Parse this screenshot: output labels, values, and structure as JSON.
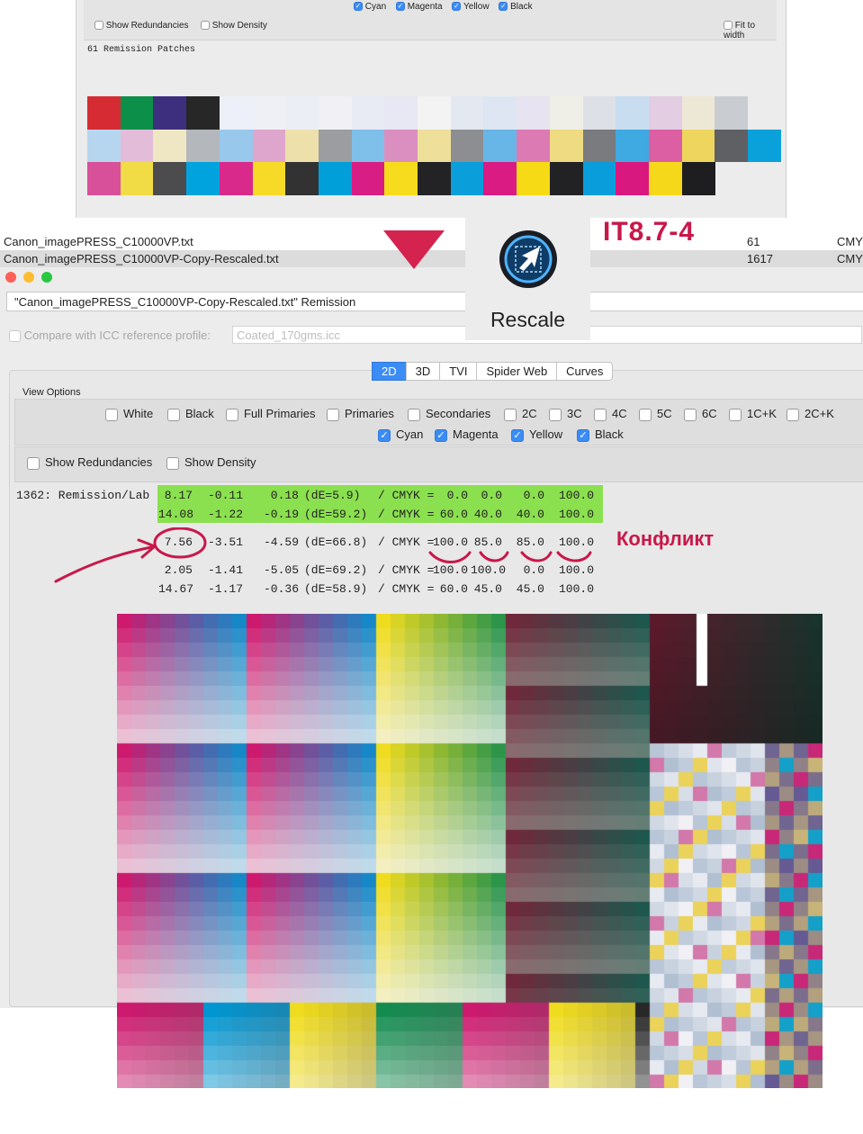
{
  "top_window": {
    "channels": [
      {
        "label": "Cyan",
        "checked": true
      },
      {
        "label": "Magenta",
        "checked": true
      },
      {
        "label": "Yellow",
        "checked": true
      },
      {
        "label": "Black",
        "checked": true
      }
    ],
    "show_redundancies": "Show Redundancies",
    "show_density": "Show Density",
    "fit_to_width": "Fit to width",
    "patch_count_label": "61 Remission Patches",
    "patch_rows": [
      [
        "#d62b33",
        "#0c8f48",
        "#3e2f7e",
        "#272727",
        "#edf0f8",
        "#eff0f6",
        "#eceef6",
        "#f1f1f5",
        "#e8eaf4",
        "#e7e8f3",
        "#f3f3f3",
        "#e4e8f1",
        "#dde6f2",
        "#e8e3f0",
        "#efefe8",
        "#dde0e6",
        "#c8ddf0",
        "#e3cde3",
        "#ede8d6",
        "#c9cdd2"
      ],
      [
        "#b6d6ef",
        "#e2bcd8",
        "#efe6c3",
        "#b4b7bb",
        "#98c8ec",
        "#dfa6cd",
        "#ede0ab",
        "#9b9da0",
        "#7fc0ea",
        "#db8fc1",
        "#eee09a",
        "#8c8e92",
        "#67b6e7",
        "#dc7ab4",
        "#eedb82",
        "#7a7b7f",
        "#3fa9e1",
        "#dc5fa4",
        "#eed65e",
        "#5f6064",
        "#0aa0d9"
      ],
      [
        "#d9509a",
        "#f2dc46",
        "#4c4c4e",
        "#00a3dd",
        "#d92a8b",
        "#f7d928",
        "#323233",
        "#009fda",
        "#d81e84",
        "#f6dc1d",
        "#232325",
        "#0a9edb",
        "#da1b84",
        "#f6da16",
        "#222224",
        "#0a9ddc",
        "#d9187f",
        "#f6d81b",
        "#1e1e20"
      ]
    ]
  },
  "file_list": [
    {
      "name": "Canon_imagePRESS_C10000VP.txt",
      "count": "61",
      "mode": "CMY"
    },
    {
      "name": "Canon_imagePRESS_C10000VP-Copy-Rescaled.txt",
      "count": "1617",
      "mode": "CMY"
    }
  ],
  "overlay": {
    "rescale_label": "Rescale",
    "rescale_icon": "rescale-arrow-icon",
    "it8_label": "IT8.7-4",
    "conflict_label": "Конфликт",
    "accent": "#c8184a"
  },
  "main_window": {
    "title": "\"Canon_imagePRESS_C10000VP-Copy-Rescaled.txt\" Remission",
    "compare_label": "Compare with ICC reference profile:",
    "compare_placeholder": "Coated_170gms.icc",
    "tabs": [
      {
        "label": "2D",
        "active": true
      },
      {
        "label": "3D",
        "active": false
      },
      {
        "label": "TVI",
        "active": false
      },
      {
        "label": "Spider Web",
        "active": false
      },
      {
        "label": "Curves",
        "active": false
      }
    ],
    "view_options_label": "View Options",
    "options_row1": [
      "White",
      "Black",
      "Full Primaries",
      "Primaries",
      "Secondaries",
      "2C",
      "3C",
      "4C",
      "5C",
      "6C",
      "1C+K",
      "2C+K"
    ],
    "options_row2": [
      "Cyan",
      "Magenta",
      "Yellow",
      "Black"
    ],
    "show_redundancies": "Show Redundancies",
    "show_density": "Show Density",
    "record_label": "1362: Remission/Lab",
    "lab_rows": [
      {
        "L": "8.17",
        "a": "-0.11",
        "b": "0.18",
        "dE": "(dE=5.9)",
        "sep": "/ CMYK =",
        "c": "0.0",
        "m": "0.0",
        "y": "0.0",
        "k": "100.0",
        "highlight": true
      },
      {
        "L": "14.08",
        "a": "-1.22",
        "b": "-0.19",
        "dE": "(dE=59.2)",
        "sep": "/ CMYK =",
        "c": "60.0",
        "m": "40.0",
        "y": "40.0",
        "k": "100.0",
        "highlight": true
      },
      {
        "L": "7.56",
        "a": "-3.51",
        "b": "-4.59",
        "dE": "(dE=66.8)",
        "sep": "/ CMYK =",
        "c": "100.0",
        "m": "85.0",
        "y": "85.0",
        "k": "100.0",
        "highlight": false
      },
      {
        "L": "2.05",
        "a": "-1.41",
        "b": "-5.05",
        "dE": "(dE=69.2)",
        "sep": "/ CMYK =",
        "c": "100.0",
        "m": "100.0",
        "y": "0.0",
        "k": "100.0",
        "highlight": false
      },
      {
        "L": "14.67",
        "a": "-1.17",
        "b": "-0.36",
        "dE": "(dE=58.9)",
        "sep": "/ CMYK =",
        "c": "60.0",
        "m": "45.0",
        "y": "45.0",
        "k": "100.0",
        "highlight": false
      }
    ],
    "highlight_color": "#8be04f"
  }
}
